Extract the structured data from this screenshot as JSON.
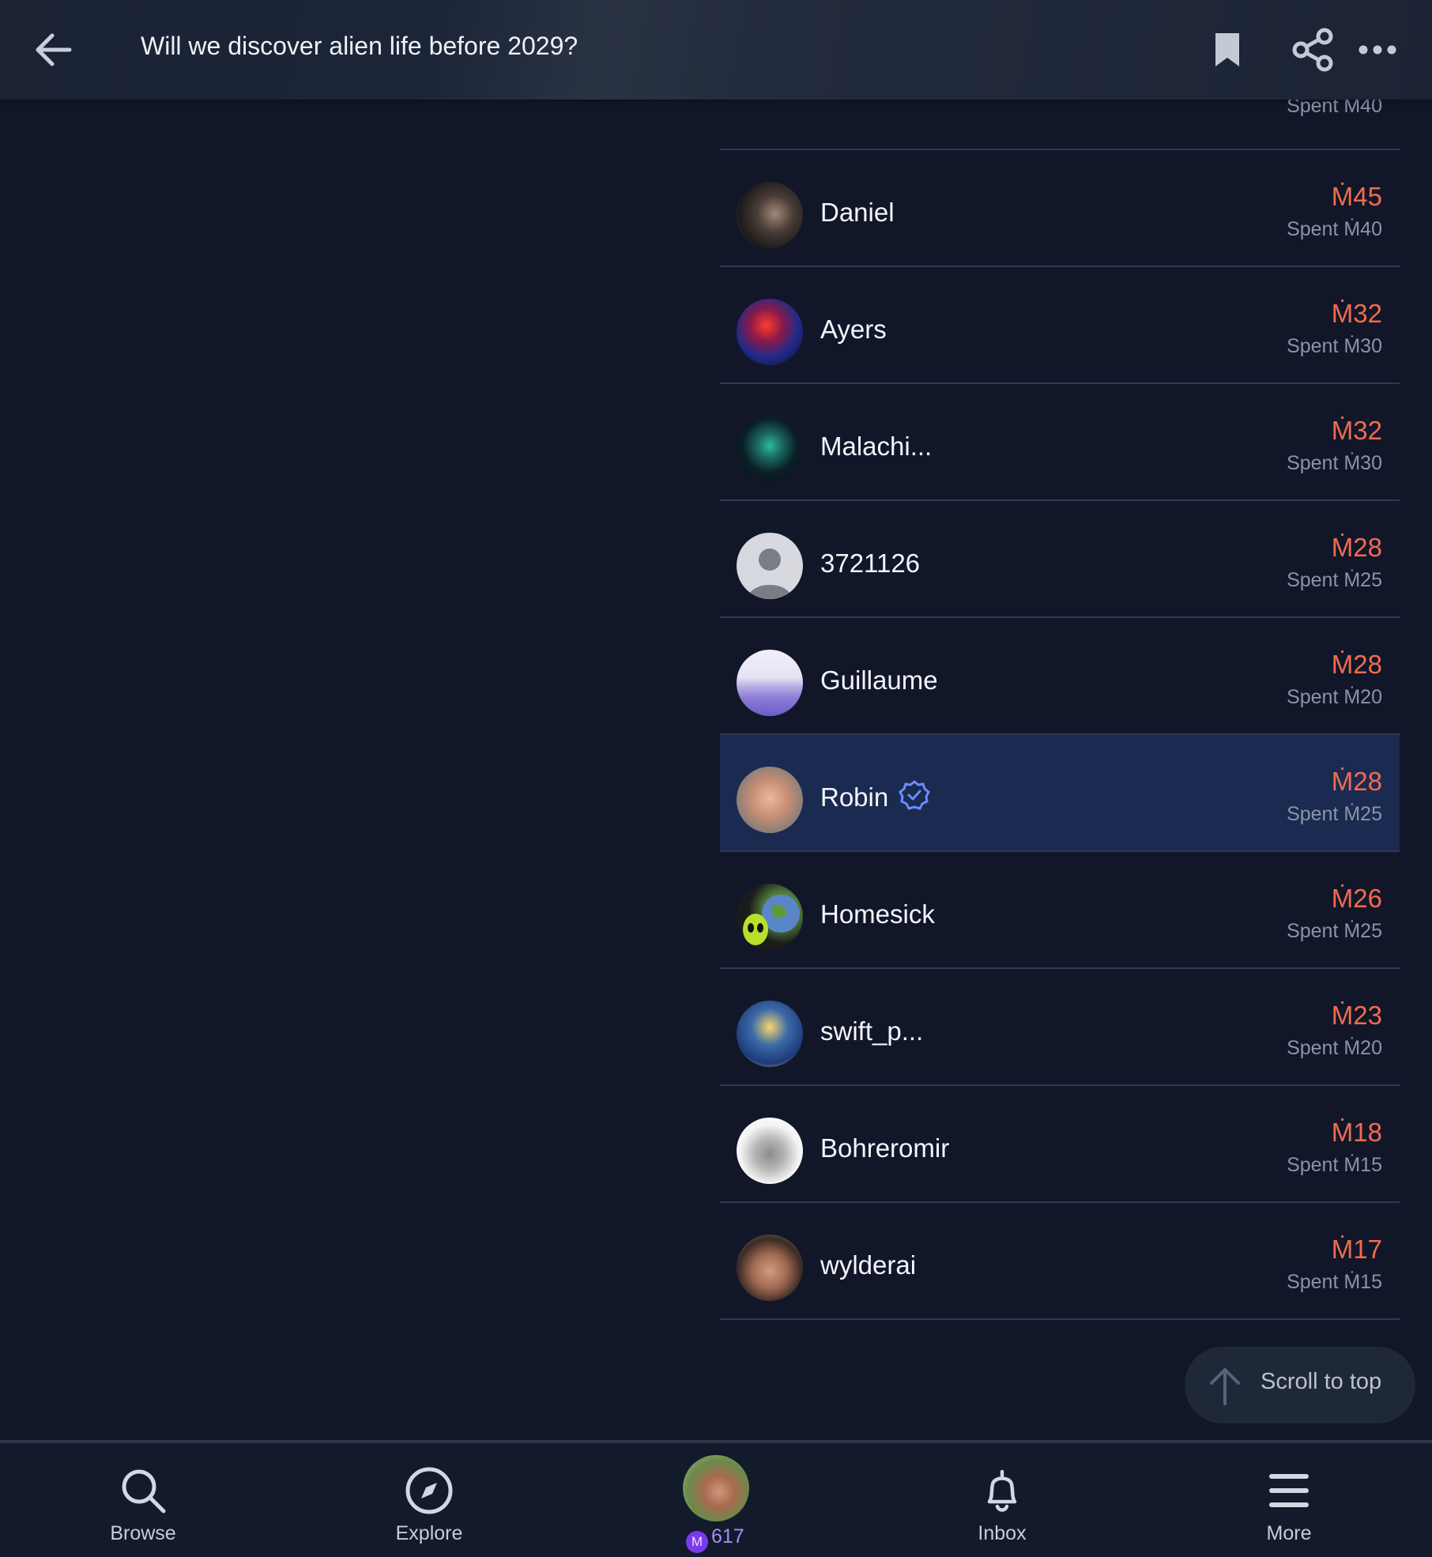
{
  "header": {
    "title": "Will we discover alien life before 2029?"
  },
  "top_row": {
    "spent": "Spent Ṁ40"
  },
  "rows": [
    {
      "name": "Daniel",
      "amount": "Ṁ45",
      "spent": "Spent Ṁ40",
      "avatar": "dark-portrait"
    },
    {
      "name": "Ayers",
      "amount": "Ṁ32",
      "spent": "Spent Ṁ30",
      "avatar": "colorful-profile"
    },
    {
      "name": "Malachi...",
      "amount": "Ṁ32",
      "spent": "Spent Ṁ30",
      "avatar": "teal-eagle"
    },
    {
      "name": "3721126",
      "amount": "Ṁ28",
      "spent": "Spent Ṁ25",
      "avatar": "default-person"
    },
    {
      "name": "Guillaume",
      "amount": "Ṁ28",
      "spent": "Spent Ṁ20",
      "avatar": "purple-landscape"
    },
    {
      "name": "Robin",
      "amount": "Ṁ28",
      "spent": "Spent Ṁ25",
      "avatar": "smiling-man",
      "verified": true,
      "highlighted": true
    },
    {
      "name": "Homesick",
      "amount": "Ṁ26",
      "spent": "Spent Ṁ25",
      "avatar": "alien-earth"
    },
    {
      "name": "swift_p...",
      "amount": "Ṁ23",
      "spent": "Spent Ṁ20",
      "avatar": "starry-night"
    },
    {
      "name": "Bohreromir",
      "amount": "Ṁ18",
      "spent": "Spent Ṁ15",
      "avatar": "kitten"
    },
    {
      "name": "wylderai",
      "amount": "Ṁ17",
      "spent": "Spent Ṁ15",
      "avatar": "man-portrait"
    }
  ],
  "scroll_to_top": {
    "label": "Scroll to top"
  },
  "nav": {
    "browse": "Browse",
    "explore": "Explore",
    "balance": "617",
    "coin_symbol": "M",
    "inbox": "Inbox",
    "more": "More"
  },
  "colors": {
    "background": "#111729",
    "amount": "#f26b4e",
    "highlight_row": "#1b2a51",
    "verified": "#6b8cff",
    "balance": "#a78bfa"
  }
}
